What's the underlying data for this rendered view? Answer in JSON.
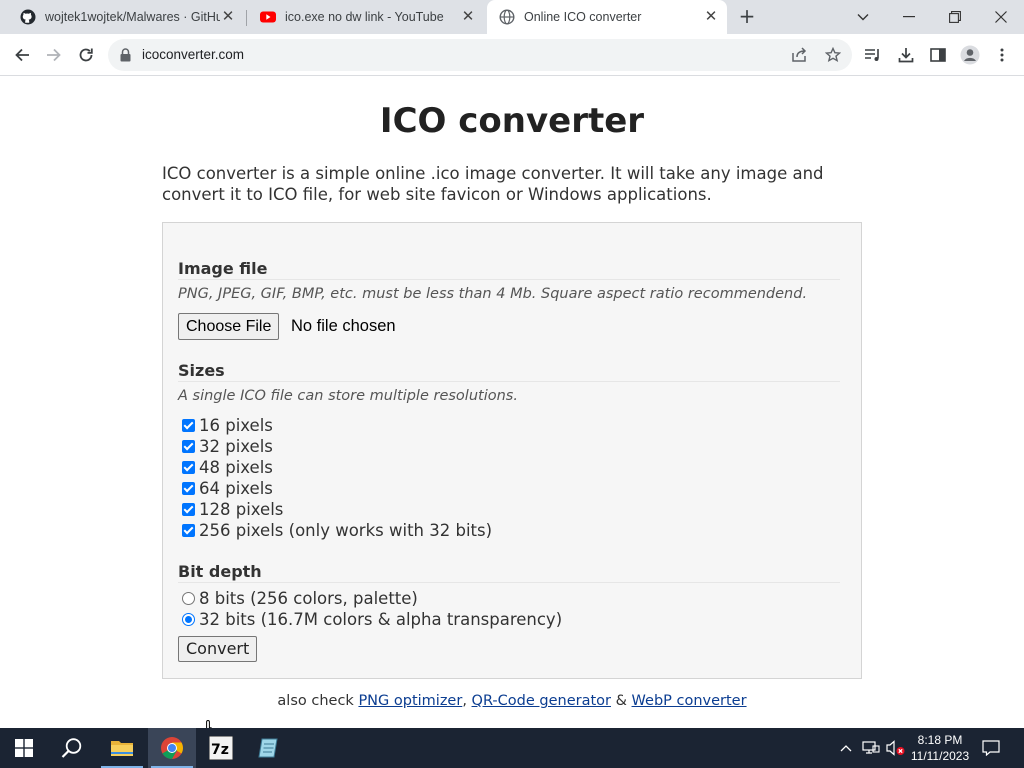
{
  "browser": {
    "tabs": [
      {
        "title": "wojtek1wojtek/Malwares · GitHub",
        "icon": "github-icon"
      },
      {
        "title": "ico.exe no dw link - YouTube",
        "icon": "youtube-icon"
      },
      {
        "title": "Online ICO converter",
        "icon": "globe-icon",
        "active": true
      }
    ],
    "url": "icoconverter.com"
  },
  "page": {
    "title": "ICO converter",
    "intro": "ICO converter is a simple online .ico image converter. It will take any image and convert it to ICO file, for web site favicon or Windows applications.",
    "image_file": {
      "heading": "Image file",
      "hint": "PNG, JPEG, GIF, BMP, etc. must be less than 4 Mb. Square aspect ratio recommendend.",
      "button_label": "Choose File",
      "status": "No file chosen"
    },
    "sizes": {
      "heading": "Sizes",
      "hint": "A single ICO file can store multiple resolutions.",
      "options": [
        {
          "label": "16 pixels",
          "checked": true
        },
        {
          "label": "32 pixels",
          "checked": true
        },
        {
          "label": "48 pixels",
          "checked": true
        },
        {
          "label": "64 pixels",
          "checked": true
        },
        {
          "label": "128 pixels",
          "checked": true
        },
        {
          "label": "256 pixels (only works with 32 bits)",
          "checked": true
        }
      ]
    },
    "bit_depth": {
      "heading": "Bit depth",
      "options": [
        {
          "label": "8 bits (256 colors, palette)",
          "selected": false
        },
        {
          "label": "32 bits (16.7M colors & alpha transparency)",
          "selected": true
        }
      ]
    },
    "convert_label": "Convert",
    "footer": {
      "prefix": "also check ",
      "link1": "PNG optimizer",
      "sep1": ", ",
      "link2": "QR-Code generator",
      "sep2": " & ",
      "link3": "WebP converter"
    }
  },
  "taskbar": {
    "time": "8:18 PM",
    "date": "11/11/2023"
  },
  "colors": {
    "accent": "#0075ff",
    "taskbar": "#1b2433",
    "tabbar": "#dee1e6"
  }
}
